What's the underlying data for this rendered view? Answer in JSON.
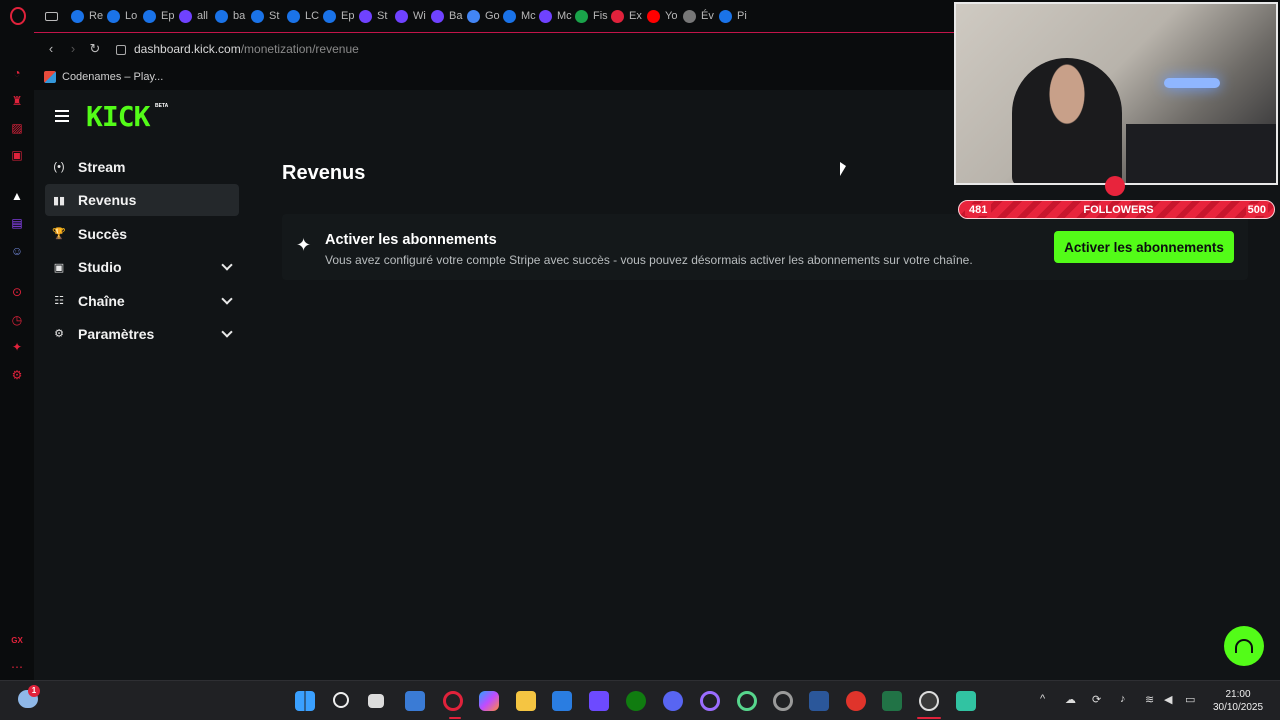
{
  "browser": {
    "tabs": [
      {
        "label": "Re",
        "color": "#1a73e8"
      },
      {
        "label": "Lo",
        "color": "#1a73e8"
      },
      {
        "label": "Ep",
        "color": "#1a73e8"
      },
      {
        "label": "all",
        "color": "#6f42ff"
      },
      {
        "label": "ba",
        "color": "#1a73e8"
      },
      {
        "label": "St",
        "color": "#1a73e8"
      },
      {
        "label": "LC",
        "color": "#1a73e8"
      },
      {
        "label": "Ep",
        "color": "#1a73e8"
      },
      {
        "label": "St",
        "color": "#6f42ff"
      },
      {
        "label": "Wi",
        "color": "#6f42ff"
      },
      {
        "label": "Ba",
        "color": "#6f42ff"
      },
      {
        "label": "Go",
        "color": "#4285f4"
      },
      {
        "label": "Mc",
        "color": "#1a73e8"
      },
      {
        "label": "Mc",
        "color": "#6f42ff"
      },
      {
        "label": "Fis",
        "color": "#1aa34a"
      },
      {
        "label": "Ex",
        "color": "#e0223b"
      },
      {
        "label": "Yo",
        "color": "#ff0000"
      },
      {
        "label": "Év",
        "color": "#777777"
      },
      {
        "label": "Pi",
        "color": "#1a73e8"
      }
    ],
    "url_domain": "dashboard.kick.com",
    "url_path": "/monetization/revenue",
    "bookmark": "Codenames – Play..."
  },
  "kick": {
    "logo": "KICK",
    "beta": "BETA",
    "accent": "#53fc18",
    "nav": [
      {
        "label": "Stream",
        "icon": "(•)",
        "name": "stream",
        "active": false,
        "expandable": false
      },
      {
        "label": "Revenus",
        "icon": "▮▮",
        "name": "revenus",
        "active": true,
        "expandable": false
      },
      {
        "label": "Succès",
        "icon": "🏆",
        "name": "succes",
        "active": false,
        "expandable": false
      },
      {
        "label": "Studio",
        "icon": "▣",
        "name": "studio",
        "active": false,
        "expandable": true
      },
      {
        "label": "Chaîne",
        "icon": "☷",
        "name": "chaine",
        "active": false,
        "expandable": true
      },
      {
        "label": "Paramètres",
        "icon": "⚙",
        "name": "parametres",
        "active": false,
        "expandable": true
      }
    ],
    "page_title": "Revenus",
    "banner": {
      "title": "Activer les abonnements",
      "text": "Vous avez configuré votre compte Stripe avec succès - vous pouvez désormais activer les abonnements sur votre chaîne.",
      "button": "Activer les abonnements"
    }
  },
  "overlay": {
    "followers_current": "481",
    "followers_label": "FOLLOWERS",
    "followers_goal": "500"
  },
  "taskbar": {
    "notification_count": "1",
    "time": "21:00",
    "date": "30/10/2025"
  }
}
